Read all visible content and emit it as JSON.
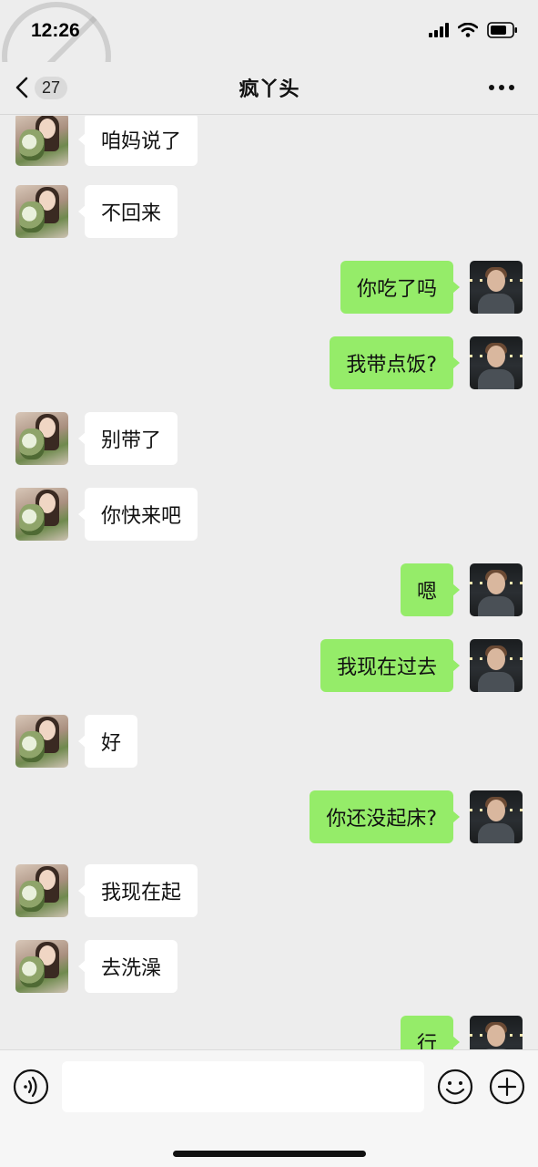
{
  "status_bar": {
    "time": "12:26"
  },
  "nav": {
    "back_count": "27",
    "title": "疯丫头"
  },
  "messages": [
    {
      "side": "left",
      "text": "咱妈说了"
    },
    {
      "side": "left",
      "text": "不回来"
    },
    {
      "side": "right",
      "text": "你吃了吗"
    },
    {
      "side": "right",
      "text": "我带点饭?"
    },
    {
      "side": "left",
      "text": "别带了"
    },
    {
      "side": "left",
      "text": "你快来吧"
    },
    {
      "side": "right",
      "text": "嗯"
    },
    {
      "side": "right",
      "text": "我现在过去"
    },
    {
      "side": "left",
      "text": "好"
    },
    {
      "side": "right",
      "text": "你还没起床?"
    },
    {
      "side": "left",
      "text": "我现在起"
    },
    {
      "side": "left",
      "text": "去洗澡"
    },
    {
      "side": "right",
      "text": "行"
    }
  ],
  "input_bar": {
    "placeholder": ""
  },
  "colors": {
    "background": "#ededed",
    "sent_bubble": "#95ec69",
    "received_bubble": "#ffffff"
  },
  "icons": {
    "back": "chevron-left-icon",
    "more": "more-dots-icon",
    "voice": "voice-icon",
    "emoji": "emoji-icon",
    "plus": "plus-icon",
    "signal": "signal-icon",
    "wifi": "wifi-icon",
    "battery": "battery-icon"
  }
}
